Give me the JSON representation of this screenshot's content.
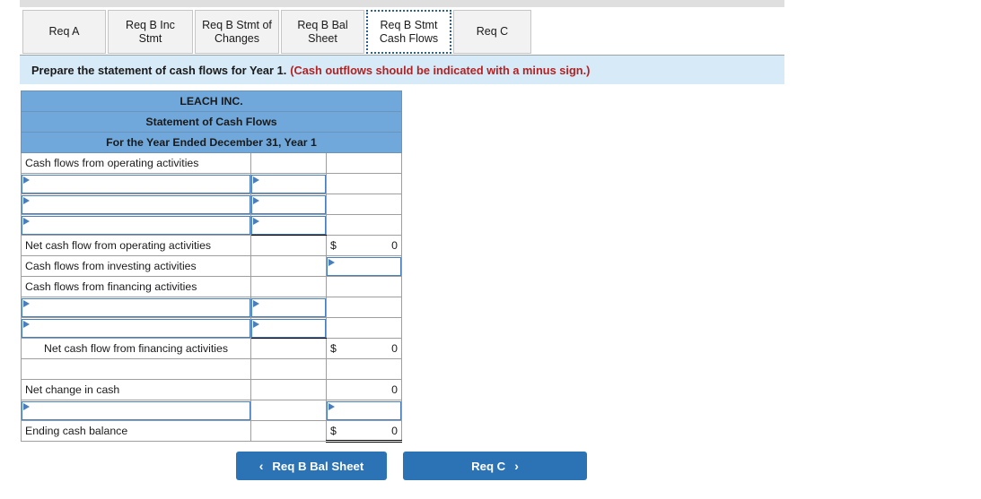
{
  "tabs": [
    {
      "label": "Req A",
      "active": false
    },
    {
      "label": "Req B Inc Stmt",
      "active": false
    },
    {
      "label": "Req B Stmt of Changes",
      "active": false
    },
    {
      "label": "Req B Bal Sheet",
      "active": false
    },
    {
      "label": "Req B Stmt Cash Flows",
      "active": true
    },
    {
      "label": "Req C",
      "active": false
    }
  ],
  "banner": {
    "text": "Prepare the statement of cash flows for Year 1.",
    "hint": "(Cash outflows should be indicated with a minus sign.)"
  },
  "statement": {
    "title_line1": "LEACH INC.",
    "title_line2": "Statement of Cash Flows",
    "title_line3": "For the Year Ended December 31, Year 1",
    "rows": [
      {
        "label": "Cash flows from operating activities",
        "type": "text",
        "mid": "",
        "amt": ""
      },
      {
        "label": "",
        "type": "select_label_mid",
        "mid": "",
        "amt": ""
      },
      {
        "label": "",
        "type": "select_label_mid",
        "mid": "",
        "amt": ""
      },
      {
        "label": "",
        "type": "select_label_mid_bottom",
        "mid": "",
        "amt": ""
      },
      {
        "label": "Net cash flow from operating activities",
        "type": "money_amt",
        "currency": "$",
        "amount": "0"
      },
      {
        "label": "Cash flows from investing activities",
        "type": "select_amt",
        "mid": "",
        "amt": ""
      },
      {
        "label": "Cash flows from financing activities",
        "type": "text",
        "mid": "",
        "amt": ""
      },
      {
        "label": "",
        "type": "select_label_mid",
        "mid": "",
        "amt": ""
      },
      {
        "label": "",
        "type": "select_label_mid_bottom",
        "mid": "",
        "amt": ""
      },
      {
        "label": "Net cash flow from financing activities",
        "type": "money_amt_indent",
        "currency": "$",
        "amount": "0"
      },
      {
        "label": "",
        "type": "blank",
        "mid": "",
        "amt": ""
      },
      {
        "label": "Net change in cash",
        "type": "num_amt",
        "amount": "0"
      },
      {
        "label": "",
        "type": "select_label_amt",
        "mid": "",
        "amt": ""
      },
      {
        "label": "Ending cash balance",
        "type": "money_amt_double",
        "currency": "$",
        "amount": "0"
      }
    ]
  },
  "nav": {
    "prev_label": "Req B Bal Sheet",
    "prev_icon": "chevron-left",
    "prev_glyph": "‹",
    "next_label": "Req C",
    "next_icon": "chevron-right",
    "next_glyph": "›"
  },
  "colors": {
    "header_blue": "#70a8db",
    "banner_blue": "#d7eaf8",
    "button_blue": "#2c73b5",
    "hint_red": "#b32222",
    "select_border": "#4a7ebb"
  }
}
